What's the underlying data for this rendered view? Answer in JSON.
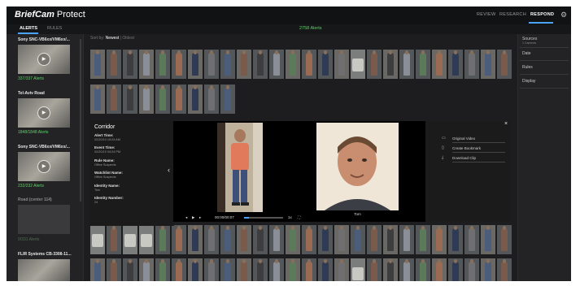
{
  "app": {
    "brand": "BriefCam",
    "product": "Protect"
  },
  "nav": {
    "review": "REVIEW",
    "research": "RESEARCH",
    "respond": "RESPOND"
  },
  "subtabs": {
    "alerts": "ALERTS",
    "rules": "RULES"
  },
  "alert_total": "2758 Alerts",
  "sort": {
    "label": "Sort by:",
    "newest": "Newest",
    "sep": "|",
    "oldest": "Oldest"
  },
  "cameras": [
    {
      "name": "Sony SNC-VB6xx/VM6xx/...",
      "count": "337/337 Alerts"
    },
    {
      "name": "Tel-Aviv Road",
      "count": "1848/1848 Alerts"
    },
    {
      "name": "Sony SNC-VB6xx/VM6xx/...",
      "count": "232/232 Alerts"
    },
    {
      "name": "Road (center 114)",
      "count": "0/331 Alerts"
    },
    {
      "name": "FLIR Systems CB-3308-11..."
    }
  ],
  "right_panel": {
    "sources": "Sources",
    "sources_sub": "1 Cameras",
    "date": "Date",
    "rules": "Rules",
    "display": "Display"
  },
  "detail": {
    "title": "Corridor",
    "fields": [
      {
        "label": "Alert Time:",
        "value": "02/20/19 15:24 AM"
      },
      {
        "label": "Event Time:",
        "value": "02/20/19 04:24 PM"
      },
      {
        "label": "Rule Name:",
        "value": "Office Suspects"
      },
      {
        "label": "Watchlist Name:",
        "value": "Office Suspects"
      },
      {
        "label": "Identity Name:",
        "value": "Tom"
      },
      {
        "label": "Identity Number:",
        "value": "24"
      }
    ],
    "watch_name": "Tom",
    "video_time": "00:00/00:07",
    "speed": "1x",
    "playback_progress": 0.12
  },
  "actions": {
    "original_video": "Original Video",
    "create_bookmark": "Create Bookmark",
    "download_clip": "Download Clip"
  },
  "icons": {
    "gear": "gear-icon",
    "play": "play-icon",
    "close": "close-icon",
    "chevron_left": "chevron-left-icon",
    "video": "video-icon",
    "bookmark": "bookmark-icon",
    "download": "download-icon"
  },
  "colors": {
    "accent": "#4aa3ff",
    "alert_green": "#5fd16a",
    "background": "#1d1d1f"
  }
}
